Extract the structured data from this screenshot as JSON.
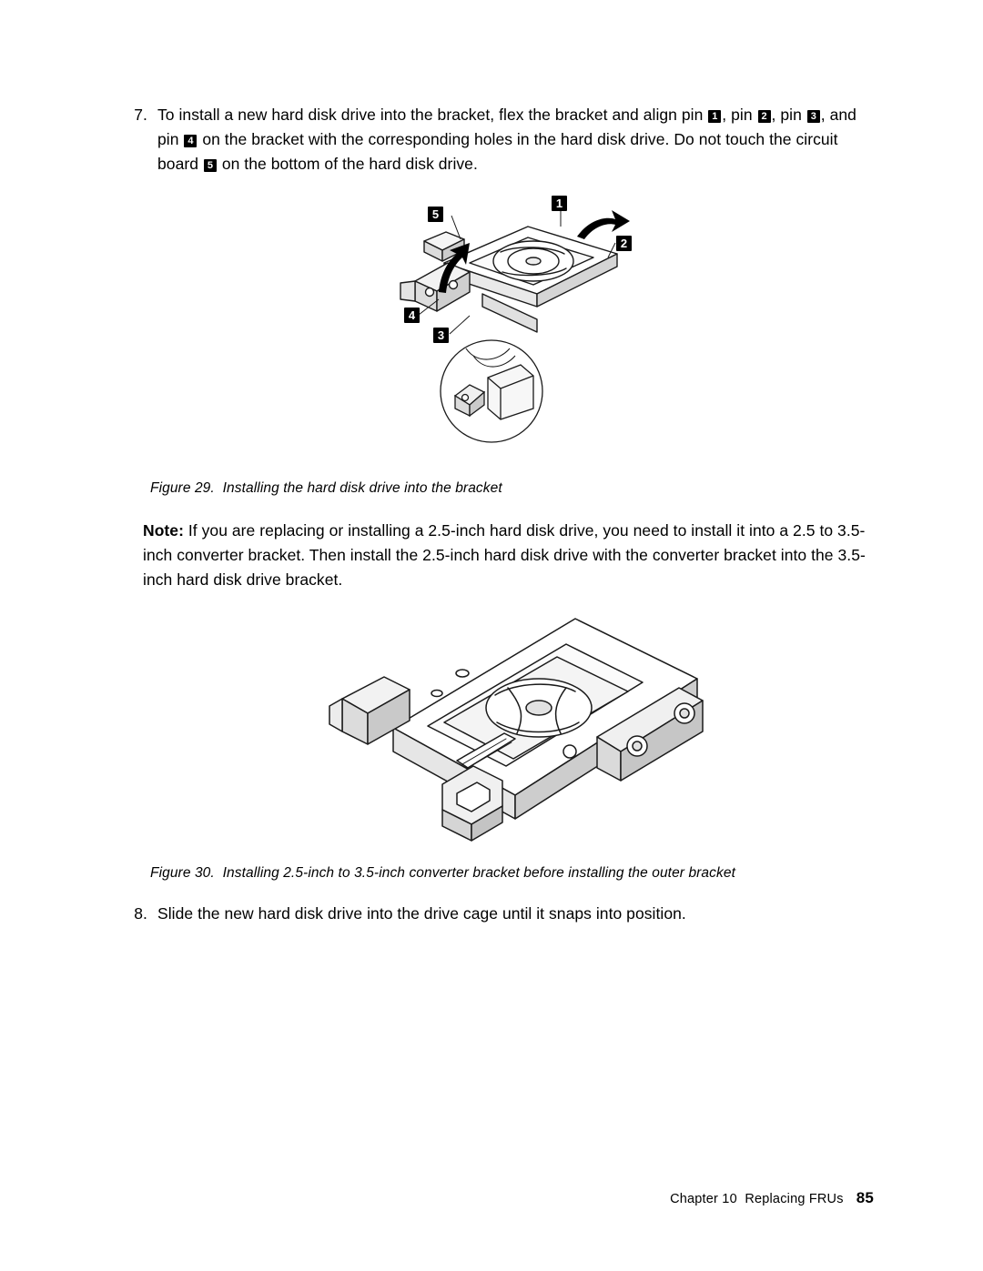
{
  "document": {
    "steps": [
      {
        "number": "7.",
        "text_parts": [
          "To install a new hard disk drive into the bracket, flex the bracket and align pin ",
          ", pin ",
          ", pin ",
          ", and pin ",
          " on the bracket with the corresponding holes in the hard disk drive. Do not touch the circuit board ",
          " on the bottom of the hard disk drive."
        ],
        "callouts": [
          "1",
          "2",
          "3",
          "4",
          "5"
        ]
      },
      {
        "number": "8.",
        "text": "Slide the new hard disk drive into the drive cage until it snaps into position."
      }
    ],
    "figures": [
      {
        "label": "Figure 29.",
        "caption": "Installing the hard disk drive into the bracket",
        "callouts": [
          "5",
          "1",
          "2",
          "4",
          "3"
        ]
      },
      {
        "label": "Figure 30.",
        "caption": "Installing 2.5-inch to 3.5-inch converter bracket before installing the outer bracket"
      }
    ],
    "note": {
      "label": "Note:",
      "text": " If you are replacing or installing a 2.5-inch hard disk drive, you need to install it into a 2.5 to 3.5-inch converter bracket. Then install the 2.5-inch hard disk drive with the converter bracket into the 3.5-inch hard disk drive bracket."
    },
    "footer": {
      "chapter": "Chapter 10",
      "section": "Replacing FRUs",
      "page": "85"
    }
  }
}
